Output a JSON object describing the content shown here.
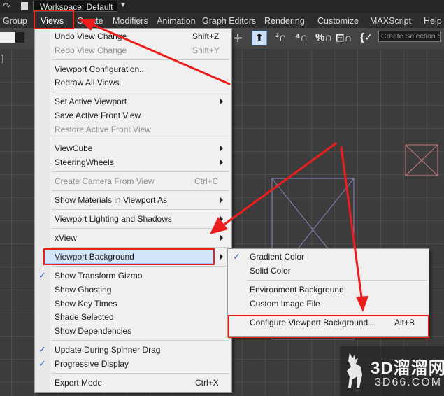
{
  "title_bar": {
    "workspace_label": "Workspace: Default"
  },
  "menubar": {
    "items": [
      "Group",
      "Views",
      "Create",
      "Modifiers",
      "Animation",
      "Graph Editors",
      "Rendering",
      "Customize",
      "MAXScript",
      "Help"
    ]
  },
  "toolbar": {
    "selection_set_placeholder": "Create Selection Se"
  },
  "views_menu": {
    "items": [
      {
        "label": "Undo View Change",
        "shortcut": "Shift+Z",
        "enabled": true
      },
      {
        "label": "Redo View Change",
        "shortcut": "Shift+Y",
        "enabled": false
      },
      {
        "label": "Viewport Configuration...",
        "shortcut": "",
        "enabled": true
      },
      {
        "label": "Redraw All Views",
        "shortcut": "",
        "enabled": true
      },
      {
        "label": "Set Active Viewport",
        "shortcut": "",
        "enabled": true,
        "submenu": true
      },
      {
        "label": "Save Active Front View",
        "shortcut": "",
        "enabled": true
      },
      {
        "label": "Restore Active Front View",
        "shortcut": "",
        "enabled": false
      },
      {
        "label": "ViewCube",
        "shortcut": "",
        "enabled": true,
        "submenu": true
      },
      {
        "label": "SteeringWheels",
        "shortcut": "",
        "enabled": true,
        "submenu": true
      },
      {
        "label": "Create Camera From View",
        "shortcut": "Ctrl+C",
        "enabled": false
      },
      {
        "label": "Show Materials in Viewport As",
        "shortcut": "",
        "enabled": true,
        "submenu": true
      },
      {
        "label": "Viewport Lighting and Shadows",
        "shortcut": "",
        "enabled": true,
        "submenu": true
      },
      {
        "label": "xView",
        "shortcut": "",
        "enabled": true,
        "submenu": true
      },
      {
        "label": "Viewport Background",
        "shortcut": "",
        "enabled": true,
        "submenu": true,
        "highlighted": true
      },
      {
        "label": "Show Transform Gizmo",
        "shortcut": "",
        "enabled": true,
        "checked": true
      },
      {
        "label": "Show Ghosting",
        "shortcut": "",
        "enabled": true
      },
      {
        "label": "Show Key Times",
        "shortcut": "",
        "enabled": true
      },
      {
        "label": "Shade Selected",
        "shortcut": "",
        "enabled": true
      },
      {
        "label": "Show Dependencies",
        "shortcut": "",
        "enabled": true
      },
      {
        "label": "Update During Spinner Drag",
        "shortcut": "",
        "enabled": true,
        "checked": true
      },
      {
        "label": "Progressive Display",
        "shortcut": "",
        "enabled": true,
        "checked": true
      },
      {
        "label": "Expert Mode",
        "shortcut": "Ctrl+X",
        "enabled": true
      }
    ]
  },
  "background_submenu": {
    "items": [
      {
        "label": "Gradient Color",
        "checked": true
      },
      {
        "label": "Solid Color",
        "checked": false
      },
      {
        "label": "Environment Background",
        "checked": false
      },
      {
        "label": "Custom Image File",
        "checked": false
      },
      {
        "label": "Configure Viewport Background...",
        "shortcut": "Alt+B",
        "checked": false
      }
    ]
  },
  "watermark": {
    "main": "3D溜溜网",
    "sub": "3D66.COM"
  },
  "colors": {
    "annotation_red": "#ee1d1d",
    "highlight": "#d2e5f9",
    "checkmark": "#2a62c8"
  }
}
